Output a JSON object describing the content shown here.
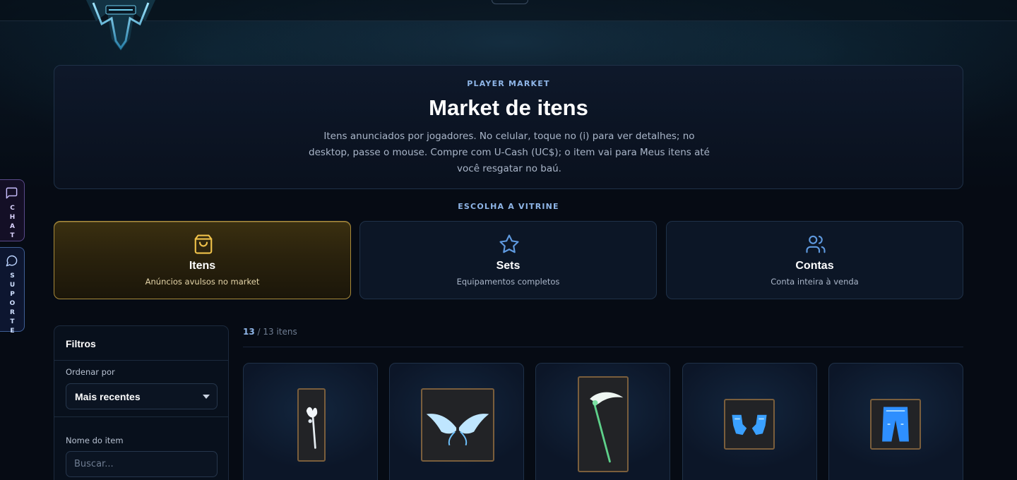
{
  "hero": {
    "kicker": "PLAYER MARKET",
    "title": "Market de itens",
    "description": "Itens anunciados por jogadores. No celular, toque no (i) para ver detalhes; no desktop, passe o mouse. Compre com U-Cash (UC$); o item vai para Meus itens até você resgatar no baú."
  },
  "vitrine": {
    "kicker": "ESCOLHA A VITRINE",
    "options": [
      {
        "title": "Itens",
        "subtitle": "Anúncios avulsos no market",
        "icon": "shopping-bag-icon",
        "active": true
      },
      {
        "title": "Sets",
        "subtitle": "Equipamentos completos",
        "icon": "star-icon",
        "active": false
      },
      {
        "title": "Contas",
        "subtitle": "Conta inteira à venda",
        "icon": "users-icon",
        "active": false
      }
    ]
  },
  "side_tabs": {
    "chat": {
      "label": "CHAT",
      "icon": "message-square-icon"
    },
    "support": {
      "label": "SUPORTE",
      "icon": "message-circle-icon"
    }
  },
  "filters": {
    "title": "Filtros",
    "sort_label": "Ordenar por",
    "sort_value": "Mais recentes",
    "name_label": "Nome do item",
    "name_placeholder": "Buscar..."
  },
  "results": {
    "shown": "13",
    "total_text": "/ 13 itens"
  },
  "items": [
    {
      "icon": "axe-item-icon"
    },
    {
      "icon": "wings-item-icon"
    },
    {
      "icon": "scythe-item-icon"
    },
    {
      "icon": "gloves-item-icon"
    },
    {
      "icon": "pants-item-icon"
    }
  ],
  "colors": {
    "accent_blue": "#8fb6e8",
    "active_gold": "#a88a3a",
    "thumb_border": "#7a5e3c",
    "item_glow": "#3aa0ff"
  }
}
